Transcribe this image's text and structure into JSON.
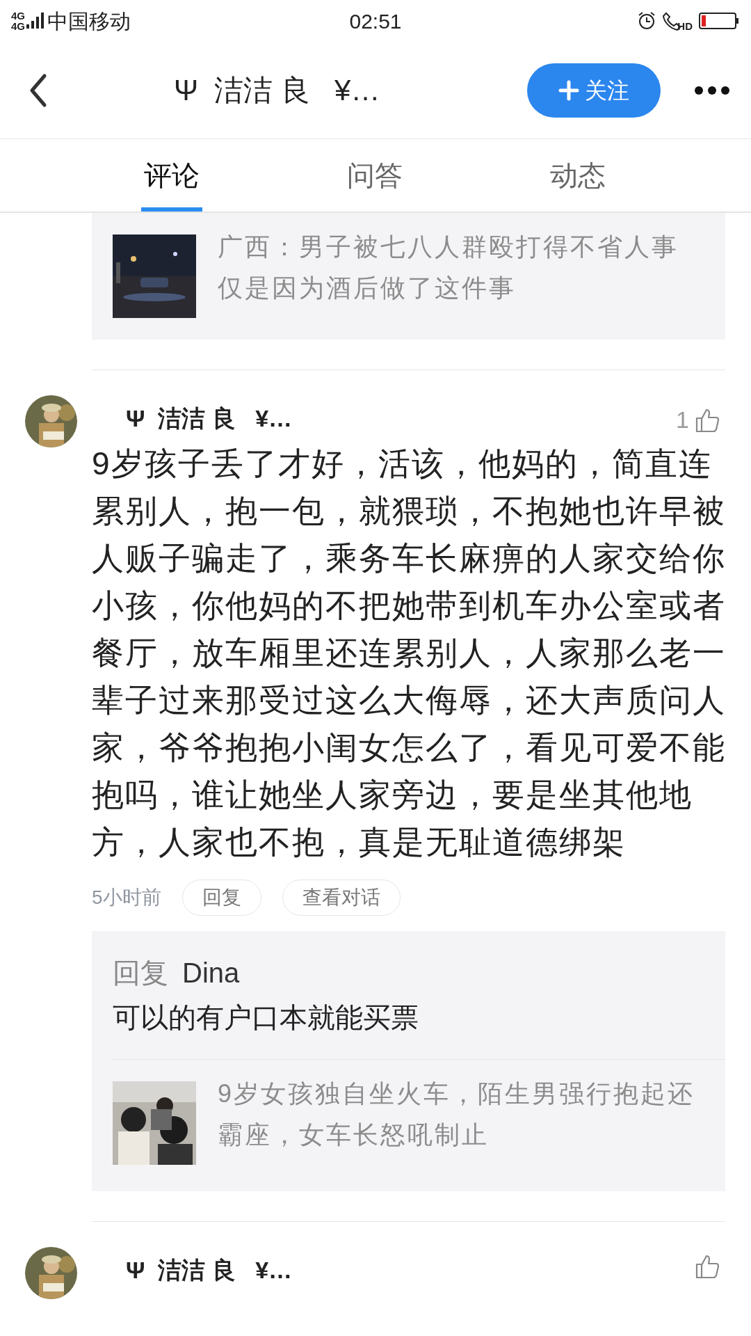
{
  "status_bar": {
    "network": [
      "4G",
      "4G"
    ],
    "carrier": "中国移动",
    "time": "02:51",
    "call_badge": "HD"
  },
  "header": {
    "title": "Ψ  洁洁 良   ¥…",
    "follow_button": "关注"
  },
  "tabs": [
    {
      "label": "评论",
      "selected": true
    },
    {
      "label": "问答",
      "selected": false
    },
    {
      "label": "动态",
      "selected": false
    }
  ],
  "linked_article": {
    "title": "广西：男子被七八人群殴打得不省人事仅是因为酒后做了这件事"
  },
  "comments": [
    {
      "author": "Ψ  洁洁 良   ¥…",
      "likes": "1",
      "body": "9岁孩子丢了才好，活该，他妈的，简直连累别人，抱一包，就猥琐，不抱她也许早被人贩子骗走了，乘务车长麻痹的人家交给你小孩，你他妈的不把她带到机车办公室或者餐厅，放车厢里还连累别人，人家那么老一辈子过来那受过这么大侮辱，还大声质问人家，爷爷抱抱小闺女怎么了，看见可爱不能抱吗，谁让她坐人家旁边，要是坐其他地方，人家也不抱，真是无耻道德绑架",
      "time": "5小时前",
      "actions": [
        "回复",
        "查看对话"
      ],
      "reply": {
        "label": "回复",
        "to": "Dina",
        "text": "可以的有户口本就能买票",
        "article": {
          "title": "9岁女孩独自坐火车，陌生男强行抱起还霸座，女车长怒吼制止"
        }
      }
    },
    {
      "author": "Ψ  洁洁 良   ¥…"
    }
  ]
}
